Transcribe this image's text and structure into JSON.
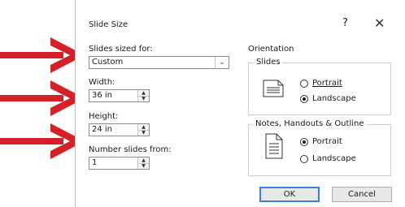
{
  "dialog": {
    "title": "Slide Size",
    "help": "?",
    "close": "✕"
  },
  "left": {
    "sized_for_label": "Slides sized for:",
    "sized_for_value": "Custom",
    "width_label": "Width:",
    "width_value": "36 in",
    "height_label": "Height:",
    "height_value": "24 in",
    "number_from_label": "Number slides from:",
    "number_from_value": "1"
  },
  "orientation": {
    "title": "Orientation",
    "slides_group": "Slides",
    "slides_options": [
      "Portrait",
      "Landscape"
    ],
    "slides_selected": "Landscape",
    "notes_group": "Notes, Handouts & Outline",
    "notes_options": [
      "Portrait",
      "Landscape"
    ],
    "notes_selected": "Portrait"
  },
  "buttons": {
    "ok": "OK",
    "cancel": "Cancel"
  },
  "colors": {
    "arrow": "#d42026",
    "default_button_border": "#3c7fd8"
  },
  "icons": [
    "red-arrow",
    "landscape-page-icon",
    "portrait-page-icon",
    "dropdown-arrow-icon",
    "spinner-up-icon",
    "spinner-down-icon"
  ]
}
